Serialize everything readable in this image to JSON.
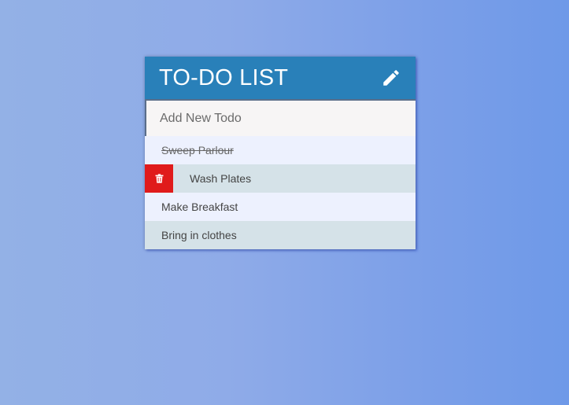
{
  "header": {
    "title": "TO-DO LIST",
    "toggle_icon": "pencil-icon"
  },
  "new_todo": {
    "placeholder": "Add New Todo",
    "value": ""
  },
  "todos": [
    {
      "text": "Sweep Parlour",
      "completed": true,
      "delete_visible": false
    },
    {
      "text": "Wash Plates",
      "completed": false,
      "delete_visible": true
    },
    {
      "text": "Make Breakfast",
      "completed": false,
      "delete_visible": false
    },
    {
      "text": "Bring in clothes",
      "completed": false,
      "delete_visible": false
    }
  ],
  "colors": {
    "header": "#2980b9",
    "delete": "#e01b1b",
    "row_odd": "#edf1fe",
    "row_even": "#d5e2e8"
  },
  "delete_icon": "trash-icon"
}
